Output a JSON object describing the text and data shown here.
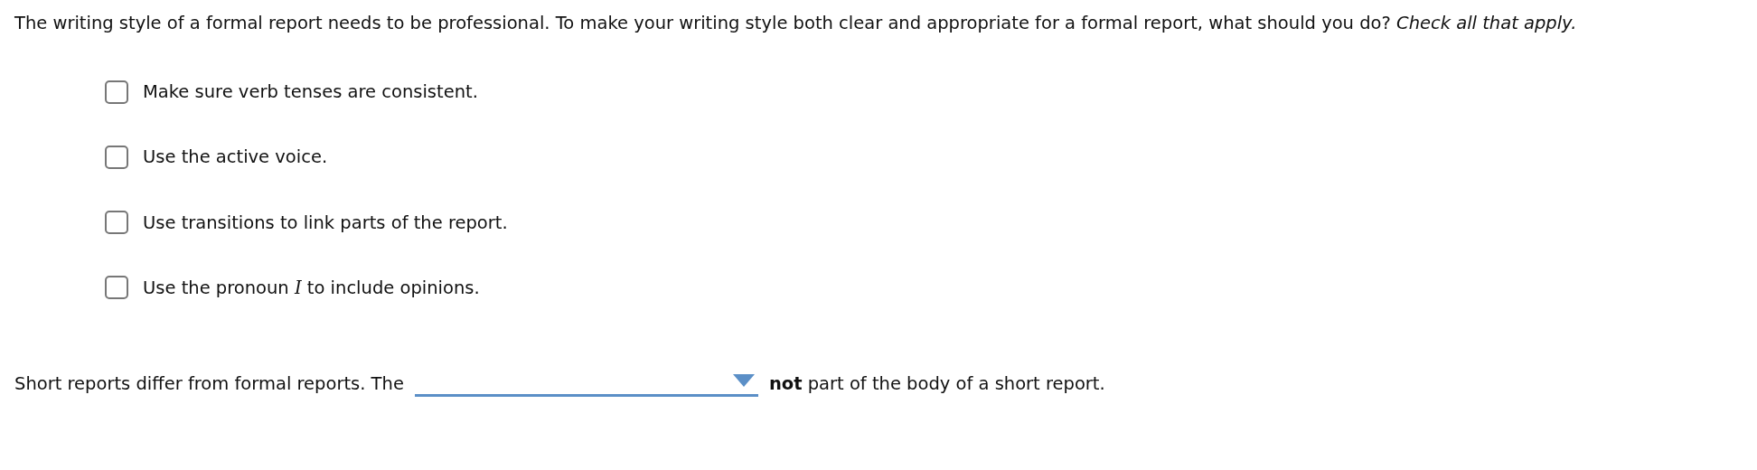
{
  "question": {
    "text": "The writing style of a formal report needs to be professional. To make your writing style both clear and appropriate for a formal report, what should you do? *Check all that apply.*"
  },
  "options": [
    {
      "label": "Make sure verb tenses are consistent.",
      "checked": false
    },
    {
      "label": "Use the active voice.",
      "checked": false
    },
    {
      "label": "Use transitions to link parts of the report.",
      "checked": false
    },
    {
      "label": "Use the pronoun *I* to include opinions.",
      "checked": false
    }
  ],
  "fill_in": {
    "before": "Short reports differ from formal reports. The",
    "after": "**not** part of the body of a short report."
  }
}
